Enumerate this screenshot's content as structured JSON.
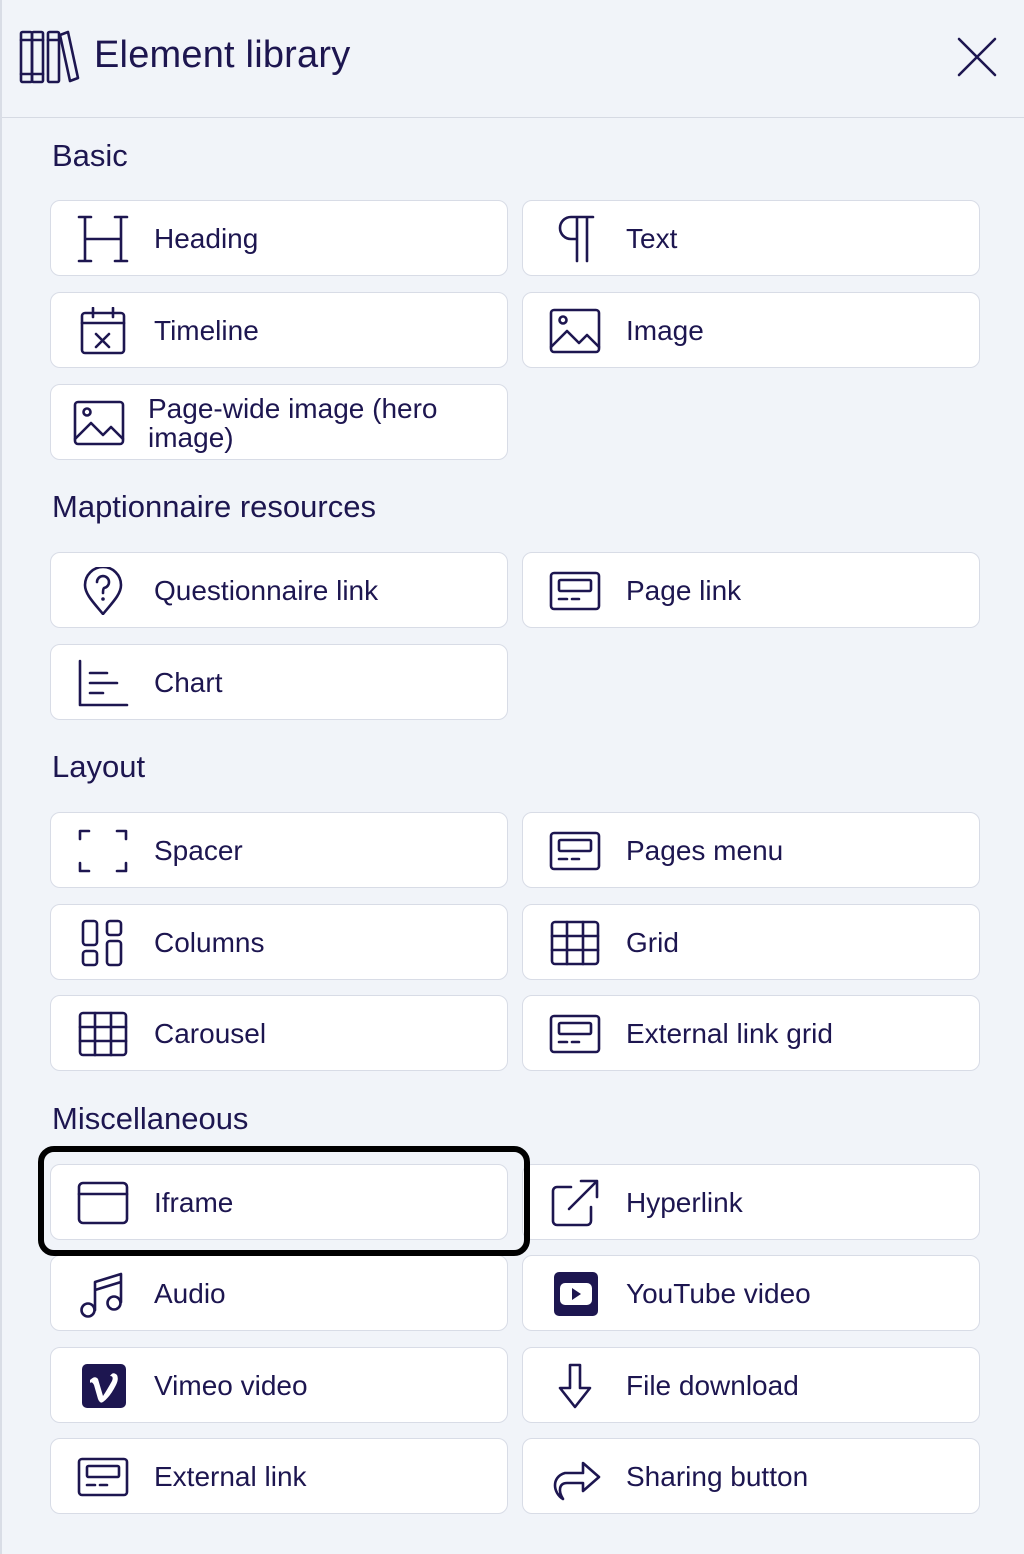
{
  "header": {
    "title": "Element library",
    "logo_icon": "books-icon",
    "close_icon": "close-icon"
  },
  "sections": {
    "basic": "Basic",
    "resources": "Maptionnaire resources",
    "layout": "Layout",
    "misc": "Miscellaneous"
  },
  "items": {
    "heading": {
      "label": "Heading",
      "icon": "heading-icon"
    },
    "text": {
      "label": "Text",
      "icon": "paragraph-icon"
    },
    "timeline": {
      "label": "Timeline",
      "icon": "calendar-icon"
    },
    "image": {
      "label": "Image",
      "icon": "image-icon"
    },
    "hero": {
      "label": "Page-wide image (hero image)",
      "icon": "image-icon"
    },
    "questionnaire_link": {
      "label": "Questionnaire link",
      "icon": "question-pin-icon"
    },
    "page_link": {
      "label": "Page link",
      "icon": "page-link-icon"
    },
    "chart": {
      "label": "Chart",
      "icon": "chart-icon"
    },
    "spacer": {
      "label": "Spacer",
      "icon": "spacer-icon"
    },
    "pages_menu": {
      "label": "Pages menu",
      "icon": "menu-icon"
    },
    "columns": {
      "label": "Columns",
      "icon": "columns-icon"
    },
    "grid": {
      "label": "Grid",
      "icon": "grid-icon"
    },
    "carousel": {
      "label": "Carousel",
      "icon": "grid-icon"
    },
    "external_link_grid": {
      "label": "External link grid",
      "icon": "link-grid-icon"
    },
    "iframe": {
      "label": "Iframe",
      "icon": "browser-window-icon"
    },
    "hyperlink": {
      "label": "Hyperlink",
      "icon": "external-arrow-icon"
    },
    "audio": {
      "label": "Audio",
      "icon": "music-note-icon"
    },
    "youtube": {
      "label": "YouTube video",
      "icon": "youtube-icon"
    },
    "vimeo": {
      "label": "Vimeo video",
      "icon": "vimeo-icon"
    },
    "file_download": {
      "label": "File download",
      "icon": "download-arrow-icon"
    },
    "external_link": {
      "label": "External link",
      "icon": "external-link-icon"
    },
    "sharing": {
      "label": "Sharing button",
      "icon": "share-arrow-icon"
    }
  },
  "selected_item": "iframe",
  "colors": {
    "background": "#f1f4f9",
    "text": "#1d1650",
    "card": "#ffffff",
    "card_border": "#d8dce6",
    "highlight": "#000000"
  }
}
